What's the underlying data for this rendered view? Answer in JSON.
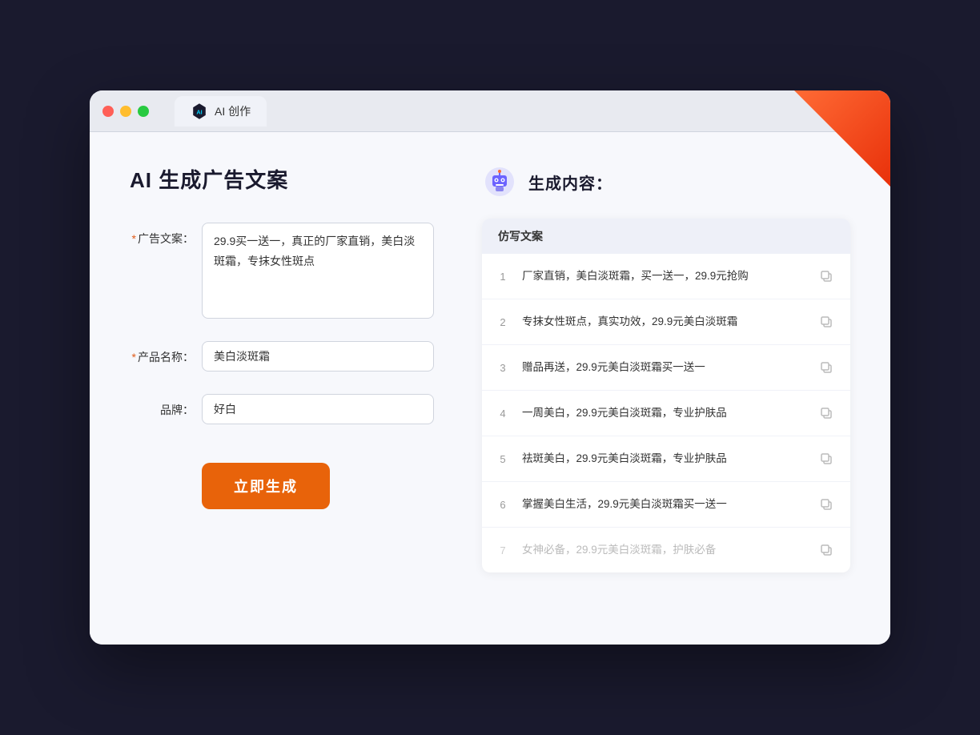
{
  "browser": {
    "tab_label": "AI 创作"
  },
  "page": {
    "title": "AI 生成广告文案",
    "right_title": "生成内容："
  },
  "form": {
    "ad_copy_label": "广告文案：",
    "ad_copy_required": "*",
    "ad_copy_value": "29.9买一送一，真正的厂家直销，美白淡斑霜，专抹女性斑点",
    "product_name_label": "产品名称：",
    "product_name_required": "*",
    "product_name_value": "美白淡斑霜",
    "brand_label": "品牌：",
    "brand_value": "好白",
    "generate_btn": "立即生成"
  },
  "table": {
    "header": "仿写文案",
    "rows": [
      {
        "number": "1",
        "text": "厂家直销，美白淡斑霜，买一送一，29.9元抢购",
        "muted": false
      },
      {
        "number": "2",
        "text": "专抹女性斑点，真实功效，29.9元美白淡斑霜",
        "muted": false
      },
      {
        "number": "3",
        "text": "赠品再送，29.9元美白淡斑霜买一送一",
        "muted": false
      },
      {
        "number": "4",
        "text": "一周美白，29.9元美白淡斑霜，专业护肤品",
        "muted": false
      },
      {
        "number": "5",
        "text": "祛斑美白，29.9元美白淡斑霜，专业护肤品",
        "muted": false
      },
      {
        "number": "6",
        "text": "掌握美白生活，29.9元美白淡斑霜买一送一",
        "muted": false
      },
      {
        "number": "7",
        "text": "女神必备，29.9元美白淡斑霜，护肤必备",
        "muted": true
      }
    ]
  }
}
